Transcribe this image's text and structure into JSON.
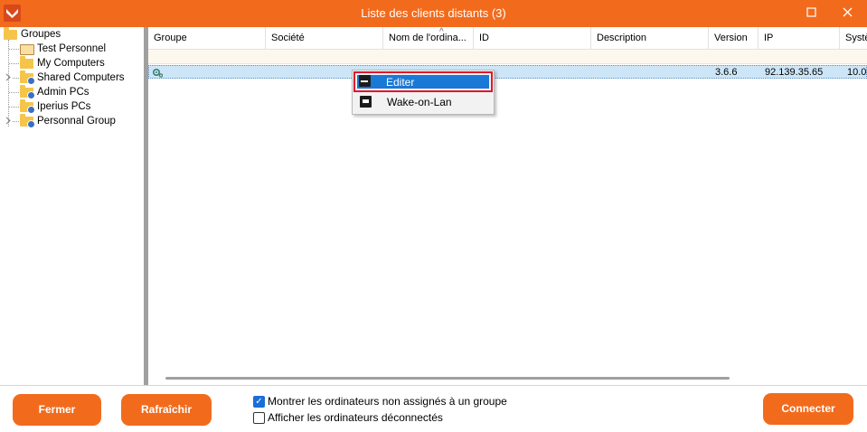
{
  "window": {
    "title": "Liste des clients distants (3)",
    "brand_color": "#f26b1d"
  },
  "tree": {
    "root": "Groupes",
    "items": [
      {
        "label": "Test Personnel",
        "expandable": false
      },
      {
        "label": "My Computers",
        "expandable": false
      },
      {
        "label": "Shared Computers",
        "expandable": true
      },
      {
        "label": "Admin PCs",
        "expandable": false
      },
      {
        "label": "Iperius PCs",
        "expandable": false
      },
      {
        "label": "Personnal Group",
        "expandable": true
      }
    ]
  },
  "grid": {
    "columns": [
      "Groupe",
      "Société",
      "Nom de l'ordina...",
      "ID",
      "Description",
      "Version",
      "IP",
      "Systè"
    ],
    "sort_indicator": "^",
    "rows": [
      {
        "groupe": "",
        "societe": "",
        "nom": "",
        "id": "",
        "description": "",
        "version": "3.6.6",
        "ip": "92.139.35.65",
        "systeme": "10.0"
      }
    ]
  },
  "context_menu": {
    "items": [
      "Editer",
      "Wake-on-Lan"
    ],
    "selected": "Editer"
  },
  "bottom": {
    "close_label": "Fermer",
    "refresh_label": "Rafraîchir",
    "connect_label": "Connecter",
    "checkbox1": {
      "label": "Montrer les ordinateurs non assignés à un groupe",
      "checked": true
    },
    "checkbox2": {
      "label": "Afficher les ordinateurs déconnectés",
      "checked": false
    }
  }
}
